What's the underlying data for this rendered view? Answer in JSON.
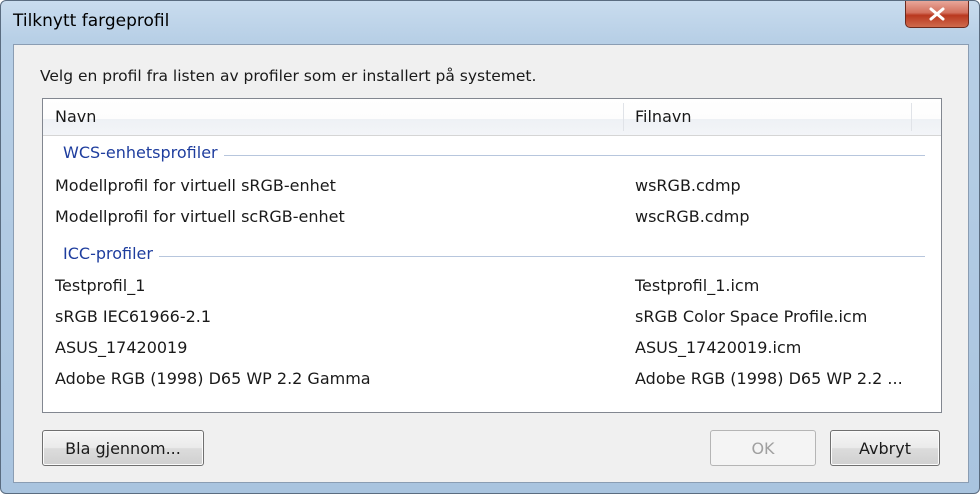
{
  "window": {
    "title": "Tilknytt fargeprofil"
  },
  "instruction": "Velg en profil fra listen av profiler som er installert på systemet.",
  "list": {
    "columns": {
      "name": "Navn",
      "file": "Filnavn"
    },
    "groups": [
      {
        "label": "WCS-enhetsprofiler",
        "rows": [
          {
            "name": "Modellprofil for virtuell sRGB-enhet",
            "file": "wsRGB.cdmp"
          },
          {
            "name": "Modellprofil for virtuell scRGB-enhet",
            "file": "wscRGB.cdmp"
          }
        ]
      },
      {
        "label": "ICC-profiler",
        "rows": [
          {
            "name": "Testprofil_1",
            "file": "Testprofil_1.icm"
          },
          {
            "name": "sRGB IEC61966-2.1",
            "file": "sRGB Color Space Profile.icm"
          },
          {
            "name": "ASUS_17420019",
            "file": "ASUS_17420019.icm"
          },
          {
            "name": "Adobe RGB (1998) D65 WP 2.2 Gamma",
            "file": "Adobe RGB (1998) D65 WP 2.2 ..."
          }
        ]
      }
    ]
  },
  "buttons": {
    "browse": "Bla gjennom...",
    "ok": "OK",
    "cancel": "Avbryt"
  },
  "icons": {
    "close": "close-icon"
  },
  "colors": {
    "group_header": "#1e3d9e",
    "close_button": "#c4472e"
  }
}
